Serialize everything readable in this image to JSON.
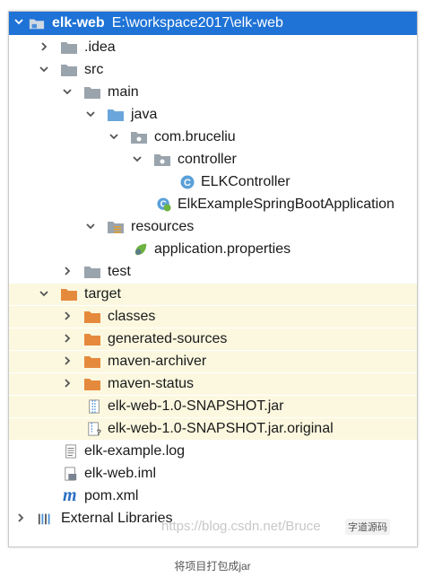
{
  "tree": {
    "root": {
      "name": "elk-web",
      "path": "E:\\workspace2017\\elk-web"
    },
    "items": [
      {
        "label": ".idea"
      },
      {
        "label": "src"
      },
      {
        "label": "main"
      },
      {
        "label": "java"
      },
      {
        "label": "com.bruceliu"
      },
      {
        "label": "controller"
      },
      {
        "label": "ELKController"
      },
      {
        "label": "ElkExampleSpringBootApplication"
      },
      {
        "label": "resources"
      },
      {
        "label": "application.properties"
      },
      {
        "label": "test"
      },
      {
        "label": "target"
      },
      {
        "label": "classes"
      },
      {
        "label": "generated-sources"
      },
      {
        "label": "maven-archiver"
      },
      {
        "label": "maven-status"
      },
      {
        "label": "elk-web-1.0-SNAPSHOT.jar"
      },
      {
        "label": "elk-web-1.0-SNAPSHOT.jar.original"
      },
      {
        "label": "elk-example.log"
      },
      {
        "label": "elk-web.iml"
      },
      {
        "label": "pom.xml"
      },
      {
        "label": "External Libraries"
      }
    ]
  },
  "watermark": {
    "url": "https://blog.csdn.net/Bruce",
    "badge": "字道源码"
  },
  "caption": "将项目打包成jar",
  "colors": {
    "selection": "#1f73d6",
    "excluded_bg": "#fbf8df",
    "folder": "#9aa4ad",
    "java_folder": "#6aa6dc",
    "excluded_folder": "#e58a3d"
  }
}
